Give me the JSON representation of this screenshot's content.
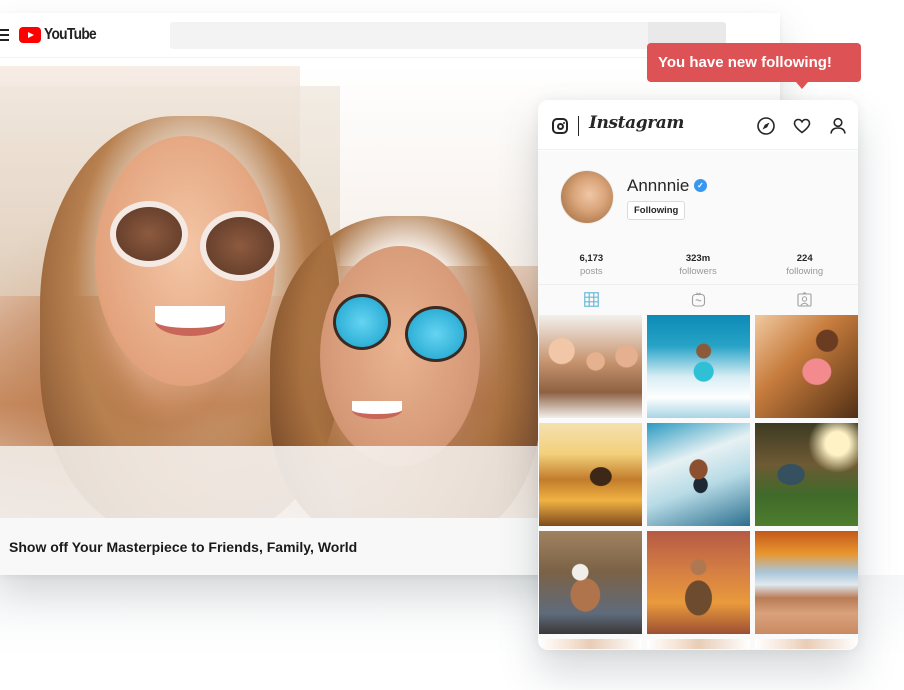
{
  "youtube": {
    "menu_icon": "hamburger-menu-icon",
    "logo_text": "YouTube",
    "search": {
      "value": "",
      "placeholder": ""
    },
    "video_title": "Show off Your Masterpiece to Friends, Family, World"
  },
  "notification": {
    "text": "You have new following!",
    "color": "#dd5254"
  },
  "instagram": {
    "wordmark": "Instagram",
    "nav_icons": [
      "camera-icon",
      "compass-icon",
      "heart-icon",
      "user-icon"
    ],
    "profile": {
      "username": "Annnnie",
      "verified": true,
      "verified_glyph": "✓",
      "follow_button": "Following"
    },
    "stats": [
      {
        "value": "6,173",
        "label": "posts"
      },
      {
        "value": "323m",
        "label": "followers"
      },
      {
        "value": "224",
        "label": "following"
      }
    ],
    "tabs": [
      {
        "name": "posts-grid",
        "icon": "grid-icon",
        "active": true
      },
      {
        "name": "igtv",
        "icon": "tv-icon",
        "active": false
      },
      {
        "name": "tagged",
        "icon": "tagged-portrait-icon",
        "active": false
      }
    ],
    "posts": [
      {
        "subject": "three friends selfie"
      },
      {
        "subject": "woman surfing wave"
      },
      {
        "subject": "woman stretching at sunset"
      },
      {
        "subject": "surfer at sunset paddling"
      },
      {
        "subject": "man surfing wave"
      },
      {
        "subject": "woman stretching on grass"
      },
      {
        "subject": "couple piggyback in beanies"
      },
      {
        "subject": "man in jacket at sunset"
      },
      {
        "subject": "canyon arch landscape"
      },
      {
        "subject": "selfie (partial)"
      },
      {
        "subject": "selfie (partial)"
      },
      {
        "subject": "selfie (partial)"
      }
    ],
    "accent_color": "#3897f0"
  }
}
